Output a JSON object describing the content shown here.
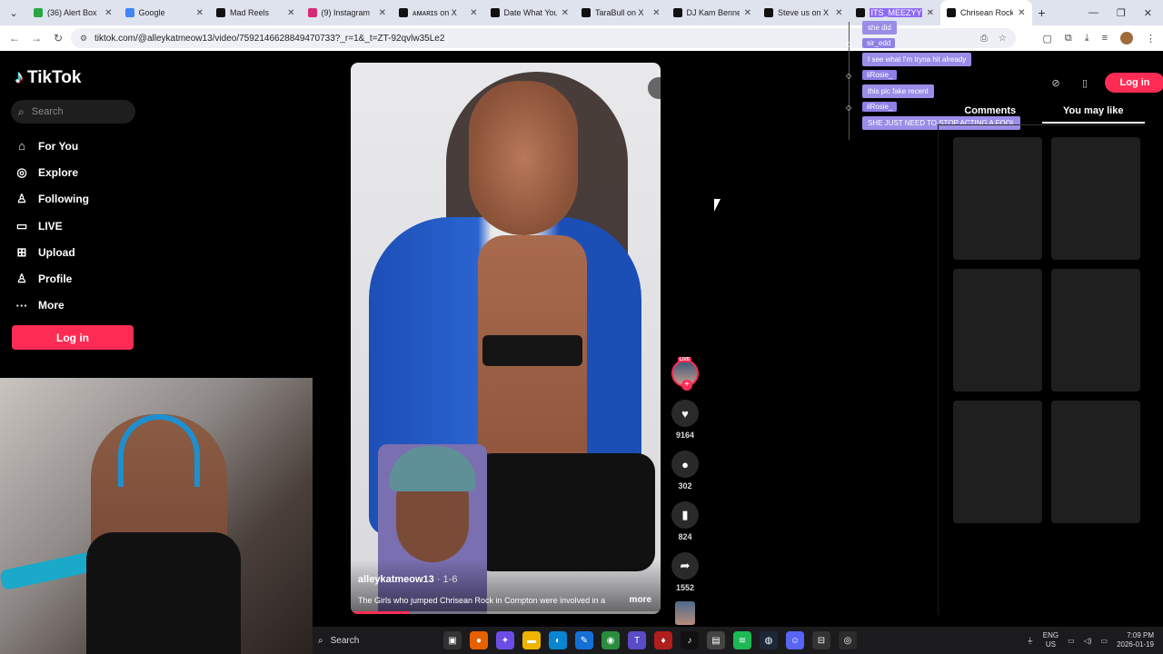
{
  "browser": {
    "tabs": [
      {
        "label": "(36) Alert Box",
        "icon_color": "#28a745",
        "icon": "alert-icon"
      },
      {
        "label": "Google",
        "icon_color": "#4285f4",
        "icon": "google-icon"
      },
      {
        "label": "Mad Reels",
        "icon_color": "#111111",
        "icon": "x-icon"
      },
      {
        "label": "(9) Instagram",
        "icon_color": "#d62976",
        "icon": "instagram-icon"
      },
      {
        "label": "ᴀᴍᴀʀɪs on X",
        "icon_color": "#111111",
        "icon": "x-icon"
      },
      {
        "label": "Date What You",
        "icon_color": "#111111",
        "icon": "tiktok-icon"
      },
      {
        "label": "TaraBull on X",
        "icon_color": "#111111",
        "icon": "x-icon"
      },
      {
        "label": "DJ Kam Benne",
        "icon_color": "#111111",
        "icon": "x-icon"
      },
      {
        "label": "Steve us on X",
        "icon_color": "#111111",
        "icon": "x-icon"
      },
      {
        "label": "ITS_MEEZYYY",
        "icon_color": "#111111",
        "icon": "tiktok-icon"
      },
      {
        "label": "Chrisean Rock",
        "icon_color": "#111111",
        "icon": "tiktok-icon"
      }
    ],
    "url": "tiktok.com/@alleykatmeow13/video/7592146628849470733?_r=1&_t=ZT-92qvlw35Le2"
  },
  "tiktok": {
    "logo_text": "TikTok",
    "search_placeholder": "Search",
    "nav": [
      {
        "label": "For You",
        "icon": "home-icon",
        "glyph": "⌂"
      },
      {
        "label": "Explore",
        "icon": "compass-icon",
        "glyph": "◎"
      },
      {
        "label": "Following",
        "icon": "following-icon",
        "glyph": "♙"
      },
      {
        "label": "LIVE",
        "icon": "live-icon",
        "glyph": "▭"
      },
      {
        "label": "Upload",
        "icon": "upload-icon",
        "glyph": "⊞"
      },
      {
        "label": "Profile",
        "icon": "profile-icon",
        "glyph": "♙"
      },
      {
        "label": "More",
        "icon": "more-icon",
        "glyph": "···"
      }
    ],
    "login_label": "Log in",
    "accent_color": "#fe2c55"
  },
  "video": {
    "author": "alleykatmeow13",
    "date": " · 1-6",
    "caption": "The Girls who jumped Chrisean Rock in Compton were involved in a",
    "more_label": "more",
    "progress": 0.19
  },
  "actions": {
    "live_badge": "LIVE",
    "likes": "9164",
    "comments": "302",
    "bookmarks": "824",
    "shares": "1552"
  },
  "chat": [
    {
      "user": "",
      "message": "she did"
    },
    {
      "user": "sir_edd",
      "message": "I see what I'm tryna hit already"
    },
    {
      "user": "iiRosie_",
      "message": "this pic fake recent"
    },
    {
      "user": "iiRosie_",
      "message": "SHE JUST NEED TO STOP ACTING A FOOL"
    }
  ],
  "right_panel": {
    "login_label": "Log in",
    "tabs": [
      "Comments",
      "You may like"
    ],
    "active_tab": 1,
    "tile_count": 6
  },
  "taskbar": {
    "search_label": "Search",
    "lang_top": "ENG",
    "lang_bottom": "US",
    "time": "7:09 PM",
    "date": "2026-01-19"
  }
}
